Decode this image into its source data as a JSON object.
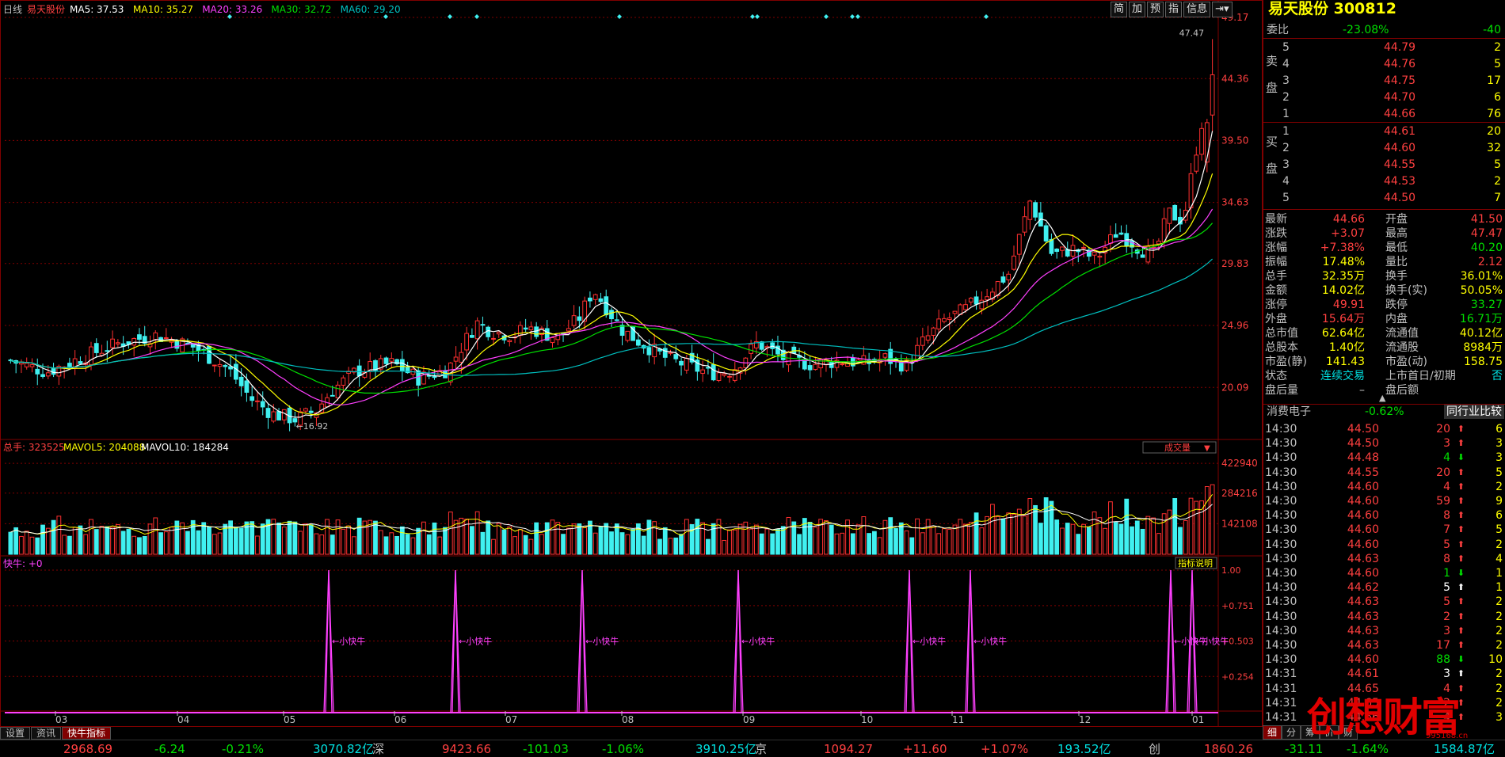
{
  "chart_header": {
    "period": "日线",
    "stock_name": "易天股份",
    "ma5": "MA5: 37.53",
    "ma10": "MA10: 35.27",
    "ma20": "MA20: 33.26",
    "ma30": "MA30: 32.72",
    "ma60": "MA60: 29.20"
  },
  "price_axis": [
    "49.17",
    "44.36",
    "39.50",
    "34.63",
    "29.83",
    "24.96",
    "20.09"
  ],
  "price_annotations": {
    "high": "47.47",
    "low": "16.92"
  },
  "volume_header": {
    "total": "总手: 323525",
    "mavol5": "MAVOL5: 204088",
    "mavol10": "MAVOL10: 184284",
    "selector": "成交量"
  },
  "volume_axis": [
    "422940",
    "284216",
    "142108"
  ],
  "indicator_header": {
    "name": "快牛: +0",
    "help": "指标说明"
  },
  "indicator_axis": [
    "1.00",
    "+0.751",
    "+0.503",
    "+0.254"
  ],
  "indicator_signal_label": "小快牛",
  "month_labels": [
    "03",
    "04",
    "05",
    "06",
    "07",
    "08",
    "09",
    "10",
    "11",
    "12",
    "01"
  ],
  "toolbar": [
    "简",
    "加",
    "预",
    "指",
    "信息"
  ],
  "bottom_tabs": [
    "设置",
    "资讯",
    "快牛指标"
  ],
  "quote": {
    "title": "易天股份 300812",
    "weibi_label": "委比",
    "weibi_value": "-23.08%",
    "weibi_diff": "-40",
    "sell_label": "卖盘",
    "buy_label": "买盘",
    "sells": [
      {
        "lvl": "5",
        "price": "44.79",
        "vol": "2"
      },
      {
        "lvl": "4",
        "price": "44.76",
        "vol": "5"
      },
      {
        "lvl": "3",
        "price": "44.75",
        "vol": "17"
      },
      {
        "lvl": "2",
        "price": "44.70",
        "vol": "6"
      },
      {
        "lvl": "1",
        "price": "44.66",
        "vol": "76"
      }
    ],
    "buys": [
      {
        "lvl": "1",
        "price": "44.61",
        "vol": "20"
      },
      {
        "lvl": "2",
        "price": "44.60",
        "vol": "32"
      },
      {
        "lvl": "3",
        "price": "44.55",
        "vol": "5"
      },
      {
        "lvl": "4",
        "price": "44.53",
        "vol": "2"
      },
      {
        "lvl": "5",
        "price": "44.50",
        "vol": "7"
      }
    ],
    "stats": [
      {
        "l1": "最新",
        "v1": "44.66",
        "c1": "#ff4040",
        "l2": "开盘",
        "v2": "41.50",
        "c2": "#ff4040"
      },
      {
        "l1": "涨跌",
        "v1": "+3.07",
        "c1": "#ff4040",
        "l2": "最高",
        "v2": "47.47",
        "c2": "#ff4040"
      },
      {
        "l1": "涨幅",
        "v1": "+7.38%",
        "c1": "#ff4040",
        "l2": "最低",
        "v2": "40.20",
        "c2": "#00e000"
      },
      {
        "l1": "振幅",
        "v1": "17.48%",
        "c1": "#ffff00",
        "l2": "量比",
        "v2": "2.12",
        "c2": "#ff4040"
      },
      {
        "l1": "总手",
        "v1": "32.35万",
        "c1": "#ffff00",
        "l2": "换手",
        "v2": "36.01%",
        "c2": "#ffff00"
      },
      {
        "l1": "金额",
        "v1": "14.02亿",
        "c1": "#ffff00",
        "l2": "换手(实)",
        "v2": "50.05%",
        "c2": "#ffff00"
      },
      {
        "l1": "涨停",
        "v1": "49.91",
        "c1": "#ff4040",
        "l2": "跌停",
        "v2": "33.27",
        "c2": "#00e000"
      },
      {
        "l1": "外盘",
        "v1": "15.64万",
        "c1": "#ff4040",
        "l2": "内盘",
        "v2": "16.71万",
        "c2": "#00e000"
      },
      {
        "l1": "总市值",
        "v1": "62.64亿",
        "c1": "#ffff00",
        "l2": "流通值",
        "v2": "40.12亿",
        "c2": "#ffff00"
      },
      {
        "l1": "总股本",
        "v1": "1.40亿",
        "c1": "#ffff00",
        "l2": "流通股",
        "v2": "8984万",
        "c2": "#ffff00"
      },
      {
        "l1": "市盈(静)",
        "v1": "141.43",
        "c1": "#ffff00",
        "l2": "市盈(动)",
        "v2": "158.75",
        "c2": "#ffff00"
      },
      {
        "l1": "状态",
        "v1": "连续交易",
        "c1": "#00e0e0",
        "l2": "上市首日/初期",
        "v2": "否",
        "c2": "#00e0e0"
      },
      {
        "l1": "盘后量",
        "v1": "–",
        "c1": "#c0c0c0",
        "l2": "盘后额",
        "v2": "",
        "c2": "#c0c0c0"
      }
    ],
    "sector": "消费电子",
    "sector_change": "-0.62%",
    "compare_btn": "同行业比较",
    "ticks": [
      {
        "t": "14:30",
        "p": "44.50",
        "v": "20",
        "d": "up",
        "n": "6"
      },
      {
        "t": "14:30",
        "p": "44.50",
        "v": "3",
        "d": "up",
        "n": "3"
      },
      {
        "t": "14:30",
        "p": "44.48",
        "v": "4",
        "d": "down",
        "n": "3"
      },
      {
        "t": "14:30",
        "p": "44.55",
        "v": "20",
        "d": "up",
        "n": "5"
      },
      {
        "t": "14:30",
        "p": "44.60",
        "v": "4",
        "d": "up",
        "n": "2"
      },
      {
        "t": "14:30",
        "p": "44.60",
        "v": "59",
        "d": "up",
        "n": "9"
      },
      {
        "t": "14:30",
        "p": "44.60",
        "v": "8",
        "d": "up",
        "n": "6"
      },
      {
        "t": "14:30",
        "p": "44.60",
        "v": "7",
        "d": "up",
        "n": "5"
      },
      {
        "t": "14:30",
        "p": "44.60",
        "v": "5",
        "d": "up",
        "n": "2"
      },
      {
        "t": "14:30",
        "p": "44.63",
        "v": "8",
        "d": "up",
        "n": "4"
      },
      {
        "t": "14:30",
        "p": "44.60",
        "v": "1",
        "d": "down",
        "n": "1"
      },
      {
        "t": "14:30",
        "p": "44.62",
        "v": "5",
        "d": "neutral",
        "n": "1"
      },
      {
        "t": "14:30",
        "p": "44.63",
        "v": "5",
        "d": "up",
        "n": "2"
      },
      {
        "t": "14:30",
        "p": "44.63",
        "v": "2",
        "d": "up",
        "n": "2"
      },
      {
        "t": "14:30",
        "p": "44.63",
        "v": "3",
        "d": "up",
        "n": "2"
      },
      {
        "t": "14:30",
        "p": "44.63",
        "v": "17",
        "d": "up",
        "n": "2"
      },
      {
        "t": "14:30",
        "p": "44.60",
        "v": "88",
        "d": "down",
        "n": "10"
      },
      {
        "t": "14:31",
        "p": "44.61",
        "v": "3",
        "d": "neutral",
        "n": "2"
      },
      {
        "t": "14:31",
        "p": "44.65",
        "v": "4",
        "d": "up",
        "n": "2"
      },
      {
        "t": "14:31",
        "p": "44.65",
        "v": "2",
        "d": "up",
        "n": "2"
      },
      {
        "t": "14:31",
        "p": "44.66",
        "v": "4",
        "d": "up",
        "n": "3"
      }
    ],
    "bottom_tabs": [
      "细",
      "分",
      "筹",
      "价",
      "财"
    ]
  },
  "status_bar": [
    {
      "v": "2968.69",
      "c": "#ff4040"
    },
    {
      "v": "-6.24",
      "c": "#00e000"
    },
    {
      "v": "-0.21%",
      "c": "#00e000"
    },
    {
      "v": "3070.82亿",
      "c": "#00e0e0"
    },
    {
      "v": "深",
      "c": "#c0c0c0"
    },
    {
      "v": "9423.66",
      "c": "#ff4040"
    },
    {
      "v": "-101.03",
      "c": "#00e000"
    },
    {
      "v": "-1.06%",
      "c": "#00e000"
    },
    {
      "v": "3910.25亿",
      "c": "#00e0e0"
    },
    {
      "v": "京",
      "c": "#c0c0c0"
    },
    {
      "v": "1094.27",
      "c": "#ff4040"
    },
    {
      "v": "+11.60",
      "c": "#ff4040"
    },
    {
      "v": "+1.07%",
      "c": "#ff4040"
    },
    {
      "v": "193.52亿",
      "c": "#00e0e0"
    },
    {
      "v": "创",
      "c": "#c0c0c0"
    },
    {
      "v": "1860.26",
      "c": "#ff4040"
    },
    {
      "v": "-31.11",
      "c": "#00e000"
    },
    {
      "v": "-1.64%",
      "c": "#00e000"
    },
    {
      "v": "1584.87亿",
      "c": "#00e0e0"
    }
  ],
  "watermark": "创想财富",
  "watermark_url": "995168.cn",
  "colors": {
    "up": "#ff3030",
    "down": "#40f0f0",
    "grid": "#800000",
    "ma5": "#ffffff",
    "ma10": "#ffff00",
    "ma20": "#ff40ff",
    "ma30": "#00e000",
    "ma60": "#00c0c0",
    "indicator": "#ff40ff"
  },
  "chart_data": {
    "type": "candlestick",
    "period": "daily",
    "y_range": [
      16.92,
      49.17
    ],
    "last_close": 44.66,
    "high": 47.47,
    "low": 16.92,
    "signal_months": [
      "05",
      "06",
      "07",
      "09",
      "10",
      "10",
      "01",
      "01"
    ]
  }
}
